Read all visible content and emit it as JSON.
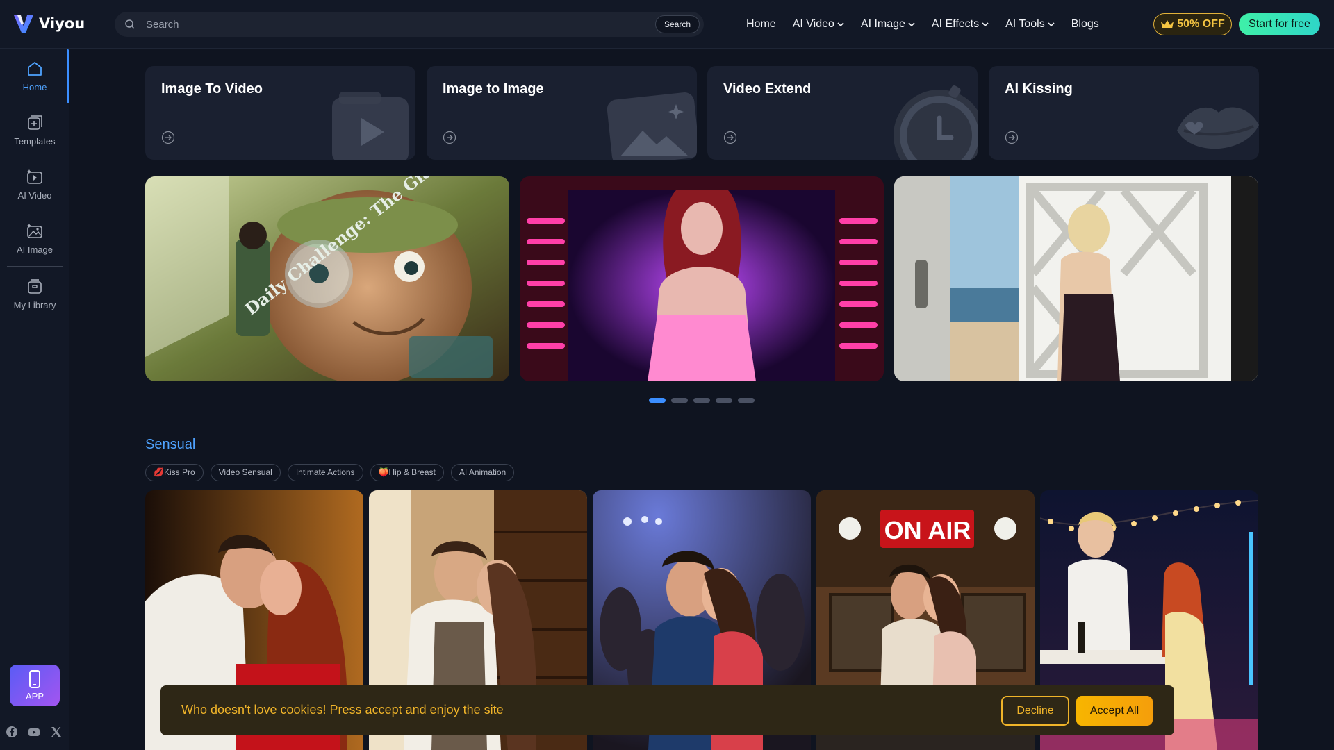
{
  "brand": {
    "name": "Viyou"
  },
  "search": {
    "placeholder": "Search",
    "button_label": "Search"
  },
  "nav": {
    "items": [
      {
        "label": "Home",
        "has_dropdown": false
      },
      {
        "label": "AI Video",
        "has_dropdown": true
      },
      {
        "label": "AI Image",
        "has_dropdown": true
      },
      {
        "label": "AI Effects",
        "has_dropdown": true
      },
      {
        "label": "AI Tools",
        "has_dropdown": true
      },
      {
        "label": "Blogs",
        "has_dropdown": false
      }
    ],
    "promo_label": "50% OFF",
    "promo_icon": "crown-icon",
    "start_label": "Start for free"
  },
  "sidebar": {
    "items": [
      {
        "label": "Home",
        "icon": "home-icon",
        "active": true
      },
      {
        "label": "Templates",
        "icon": "templates-icon",
        "active": false
      },
      {
        "label": "AI Video",
        "icon": "ai-video-icon",
        "active": false
      },
      {
        "label": "AI Image",
        "icon": "ai-image-icon",
        "active": false
      },
      {
        "label": "My Library",
        "icon": "library-icon",
        "active": false
      }
    ],
    "app_label": "APP",
    "socials": [
      "facebook-icon",
      "youtube-icon",
      "x-icon"
    ]
  },
  "features": [
    {
      "title": "Image To Video",
      "icon": "video-camera-icon"
    },
    {
      "title": "Image to Image",
      "icon": "image-sparkle-icon"
    },
    {
      "title": "Video Extend",
      "icon": "clock-icon"
    },
    {
      "title": "AI Kissing",
      "icon": "lips-icon"
    }
  ],
  "carousel": {
    "slides": [
      {
        "overlay_text": "Daily Challenge: The Giant's Optician"
      },
      {
        "overlay_text": ""
      },
      {
        "overlay_text": ""
      }
    ],
    "total_dots": 5,
    "active_dot": 0
  },
  "section": {
    "title": "Sensual",
    "chips": [
      {
        "label": "Kiss Pro",
        "prefix": "💋"
      },
      {
        "label": "Video Sensual",
        "prefix": ""
      },
      {
        "label": "Intimate Actions",
        "prefix": ""
      },
      {
        "label": "Hip & Breast",
        "prefix": "🍑"
      },
      {
        "label": "AI Animation",
        "prefix": ""
      }
    ],
    "cards": [
      {
        "caption": ""
      },
      {
        "caption": ""
      },
      {
        "caption": ""
      },
      {
        "caption": "ON AIR"
      },
      {
        "caption": ""
      }
    ]
  },
  "cookie": {
    "message": "Who doesn't love cookies! Press accept and enjoy the site",
    "decline_label": "Decline",
    "accept_label": "Accept All"
  },
  "colors": {
    "accent": "#3b8eff",
    "promo": "#f5c542",
    "start_gradient": "#3ff0a8",
    "cookie_text": "#f0b429",
    "background": "#0f1420"
  }
}
